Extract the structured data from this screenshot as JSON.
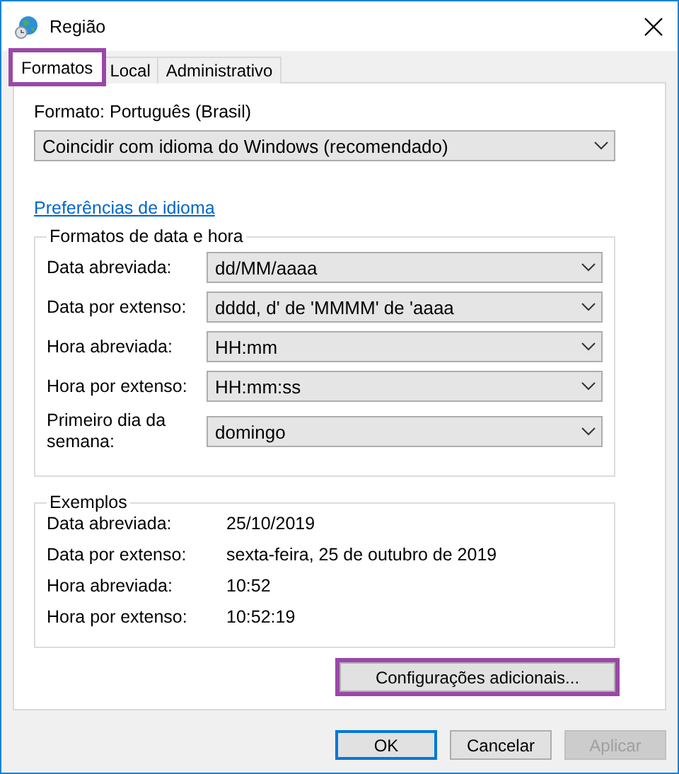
{
  "window": {
    "title": "Região"
  },
  "tabs": [
    {
      "label": "Formatos",
      "selected": true,
      "highlighted": true
    },
    {
      "label": "Local",
      "selected": false,
      "highlighted": false
    },
    {
      "label": "Administrativo",
      "selected": false,
      "highlighted": false
    }
  ],
  "format": {
    "label": "Formato: Português (Brasil)",
    "value": "Coincidir com idioma do Windows (recomendado)"
  },
  "language_link": "Preferências de idioma",
  "date_time_formats": {
    "title": "Formatos de data e hora",
    "rows": [
      {
        "label": "Data abreviada:",
        "value": "dd/MM/aaaa"
      },
      {
        "label": "Data por extenso:",
        "value": "dddd, d' de 'MMMM' de 'aaaa"
      },
      {
        "label": "Hora abreviada:",
        "value": "HH:mm"
      },
      {
        "label": "Hora por extenso:",
        "value": "HH:mm:ss"
      },
      {
        "label": "Primeiro dia da semana:",
        "value": "domingo"
      }
    ]
  },
  "examples": {
    "title": "Exemplos",
    "rows": [
      {
        "label": "Data abreviada:",
        "value": "25/10/2019"
      },
      {
        "label": "Data por extenso:",
        "value": "sexta-feira, 25 de outubro de 2019"
      },
      {
        "label": "Hora abreviada:",
        "value": "10:52"
      },
      {
        "label": "Hora por extenso:",
        "value": "10:52:19"
      }
    ]
  },
  "additional_button": {
    "label": "Configurações adicionais...",
    "highlighted": true
  },
  "buttons": [
    {
      "label": "OK",
      "default": true,
      "disabled": false
    },
    {
      "label": "Cancelar",
      "default": false,
      "disabled": false
    },
    {
      "label": "Aplicar",
      "default": false,
      "disabled": true
    }
  ]
}
